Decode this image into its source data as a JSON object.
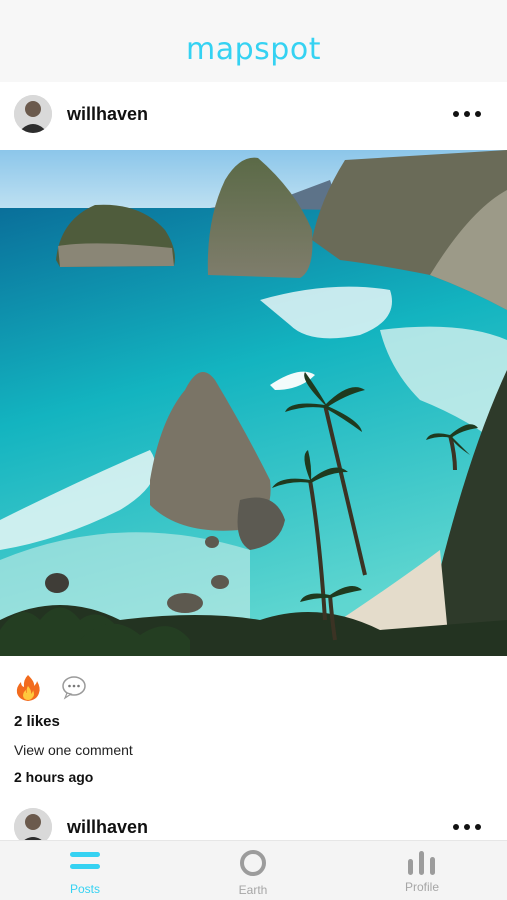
{
  "app": {
    "title": "mapspot"
  },
  "posts": [
    {
      "username": "willhaven",
      "likes": "2 likes",
      "comments_link": "View one comment",
      "timestamp": "2 hours ago"
    },
    {
      "username": "willhaven"
    }
  ],
  "tabs": [
    {
      "label": "Posts",
      "icon": "menu-icon",
      "active": true
    },
    {
      "label": "Earth",
      "icon": "globe-ring-icon",
      "active": false
    },
    {
      "label": "Profile",
      "icon": "bar-chart-icon",
      "active": false
    }
  ],
  "colors": {
    "accent": "#35d2f2",
    "inactive": "#a6a6a6"
  }
}
